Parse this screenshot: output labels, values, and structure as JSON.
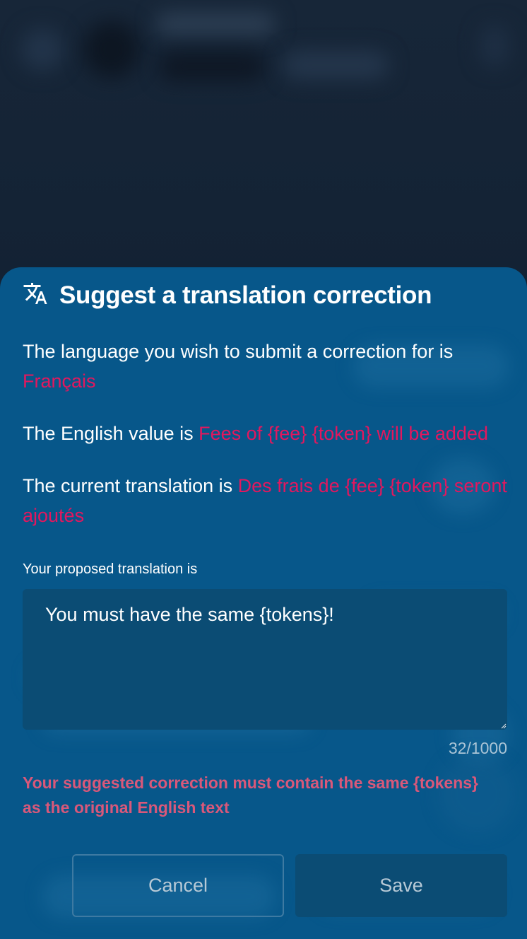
{
  "dialog": {
    "icon": "translate-icon",
    "title": "Suggest a translation correction",
    "language_prefix": "The language you wish to submit a correction for is",
    "language_value": "Français",
    "english_prefix": "The English value is",
    "english_value": "Fees of {fee} {token} will be added",
    "current_prefix": "The current translation is",
    "current_value": "Des frais de {fee} {token} seront ajoutés",
    "proposed_label": "Your proposed translation is",
    "proposed_value": "You must have the same {tokens}!",
    "char_counter": "32/1000",
    "error_message": "Your suggested correction must contain the same {tokens} as the original English text",
    "cancel_label": "Cancel",
    "save_label": "Save"
  },
  "colors": {
    "sheet_background": "#07578a",
    "highlight": "#e3175e",
    "error": "#d9587a",
    "input_background": "#0b4c74"
  }
}
